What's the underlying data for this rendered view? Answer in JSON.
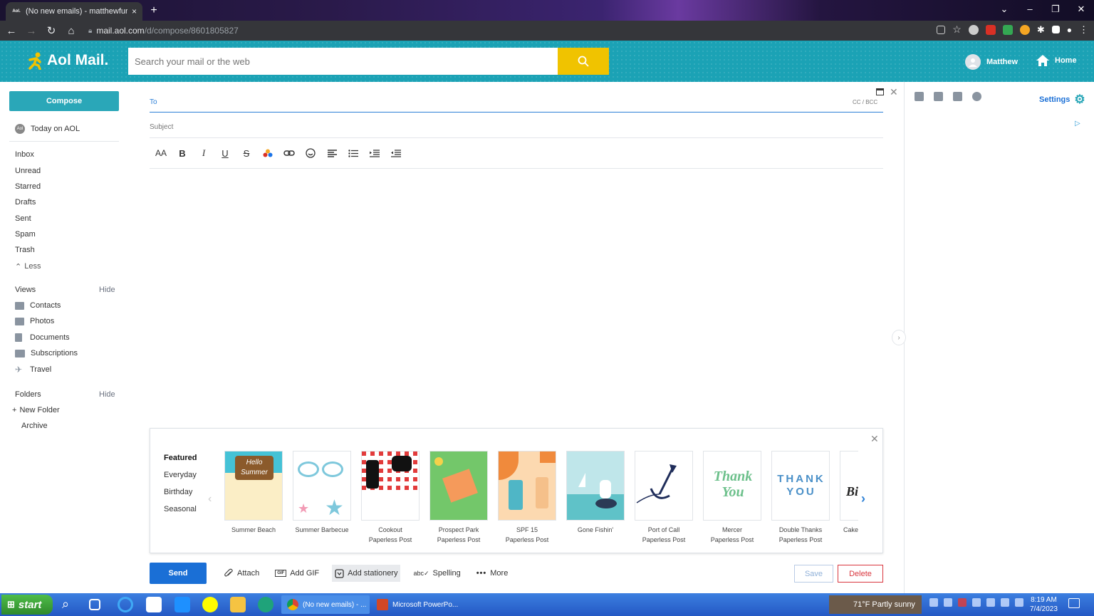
{
  "browser": {
    "tab_title": "(No new emails) - matthewfurma",
    "tab_favicon": "Aol.",
    "url_host": "mail.aol.com",
    "url_path": "/d/compose/8601805827",
    "new_tab": "+",
    "close_tab": "×"
  },
  "header": {
    "logo_text": "Aol Mail.",
    "search_placeholder": "Search your mail or the web",
    "user_name": "Matthew",
    "home_label": "Home"
  },
  "sidebar": {
    "compose_label": "Compose",
    "today_label": "Today on AOL",
    "folders": [
      {
        "label": "Inbox"
      },
      {
        "label": "Unread"
      },
      {
        "label": "Starred"
      },
      {
        "label": "Drafts"
      },
      {
        "label": "Sent"
      },
      {
        "label": "Spam"
      },
      {
        "label": "Trash"
      }
    ],
    "less_label": "Less",
    "views_label": "Views",
    "views_hide": "Hide",
    "views": [
      {
        "label": "Contacts",
        "icon": "contacts-icon"
      },
      {
        "label": "Photos",
        "icon": "photos-icon"
      },
      {
        "label": "Documents",
        "icon": "documents-icon"
      },
      {
        "label": "Subscriptions",
        "icon": "subscriptions-icon"
      },
      {
        "label": "Travel",
        "icon": "travel-icon"
      }
    ],
    "folders_label": "Folders",
    "folders_hide": "Hide",
    "new_folder_label": "New Folder",
    "archive_label": "Archive"
  },
  "compose": {
    "to_label": "To",
    "cc_bcc_label": "CC / BCC",
    "subject_label": "Subject"
  },
  "stationery": {
    "categories": [
      "Featured",
      "Everyday",
      "Birthday",
      "Seasonal"
    ],
    "cards": [
      {
        "name": "Summer Beach",
        "source": ""
      },
      {
        "name": "Summer Barbecue",
        "source": ""
      },
      {
        "name": "Cookout",
        "source": "Paperless Post"
      },
      {
        "name": "Prospect Park",
        "source": "Paperless Post"
      },
      {
        "name": "SPF 15",
        "source": "Paperless Post"
      },
      {
        "name": "Gone Fishin'",
        "source": ""
      },
      {
        "name": "Port of Call",
        "source": "Paperless Post"
      },
      {
        "name": "Mercer",
        "source": "Paperless Post"
      },
      {
        "name": "Double Thanks",
        "source": "Paperless Post"
      },
      {
        "name": "Cake",
        "source": ""
      }
    ]
  },
  "actions": {
    "send_label": "Send",
    "attach_label": "Attach",
    "gif_label": "Add GIF",
    "stationery_label": "Add stationery",
    "spelling_label": "Spelling",
    "more_label": "More",
    "save_label": "Save",
    "delete_label": "Delete"
  },
  "right_panel": {
    "settings_label": "Settings"
  },
  "taskbar": {
    "start_label": "start",
    "apps": [
      {
        "label": "(No new emails) - ..."
      },
      {
        "label": "Microsoft PowerPo..."
      }
    ],
    "weather": "71°F  Partly sunny",
    "time": "8:19 AM",
    "date": "7/4/2023"
  },
  "colors": {
    "brand_teal": "#1ba2b5",
    "search_button": "#f0c300",
    "send_blue": "#1a6fd6",
    "delete_red": "#d9363e"
  }
}
